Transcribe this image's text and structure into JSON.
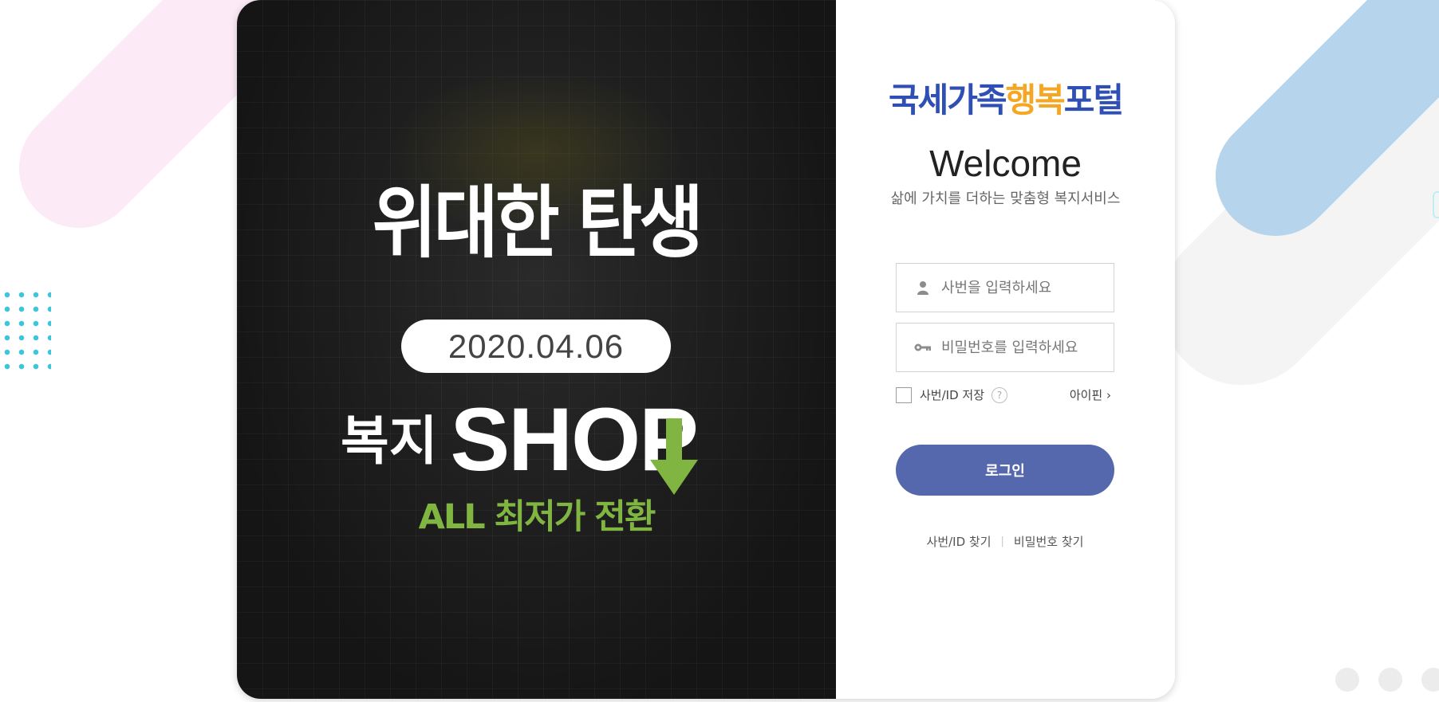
{
  "promo": {
    "title": "위대한 탄생",
    "date": "2020.04.06",
    "shop_prefix": "복지",
    "shop_word": "SHOP",
    "subtitle": "ALL 최저가 전환",
    "accent_color": "#7fb540"
  },
  "login": {
    "logo": {
      "part1": "국세가족",
      "part2": "행복",
      "part3": "포털"
    },
    "welcome": "Welcome",
    "subtitle": "삶에 가치를 더하는 맞춤형 복지서비스",
    "id_placeholder": "사번을 입력하세요",
    "pw_placeholder": "비밀번호를 입력하세요",
    "save_label": "사번/ID 저장",
    "help_icon_text": "?",
    "ipin_label": "아이핀 ›",
    "login_button": "로그인",
    "find_id": "사번/ID 찾기",
    "separator": "|",
    "find_password": "비밀번호 찾기",
    "button_color": "#5567ad"
  }
}
